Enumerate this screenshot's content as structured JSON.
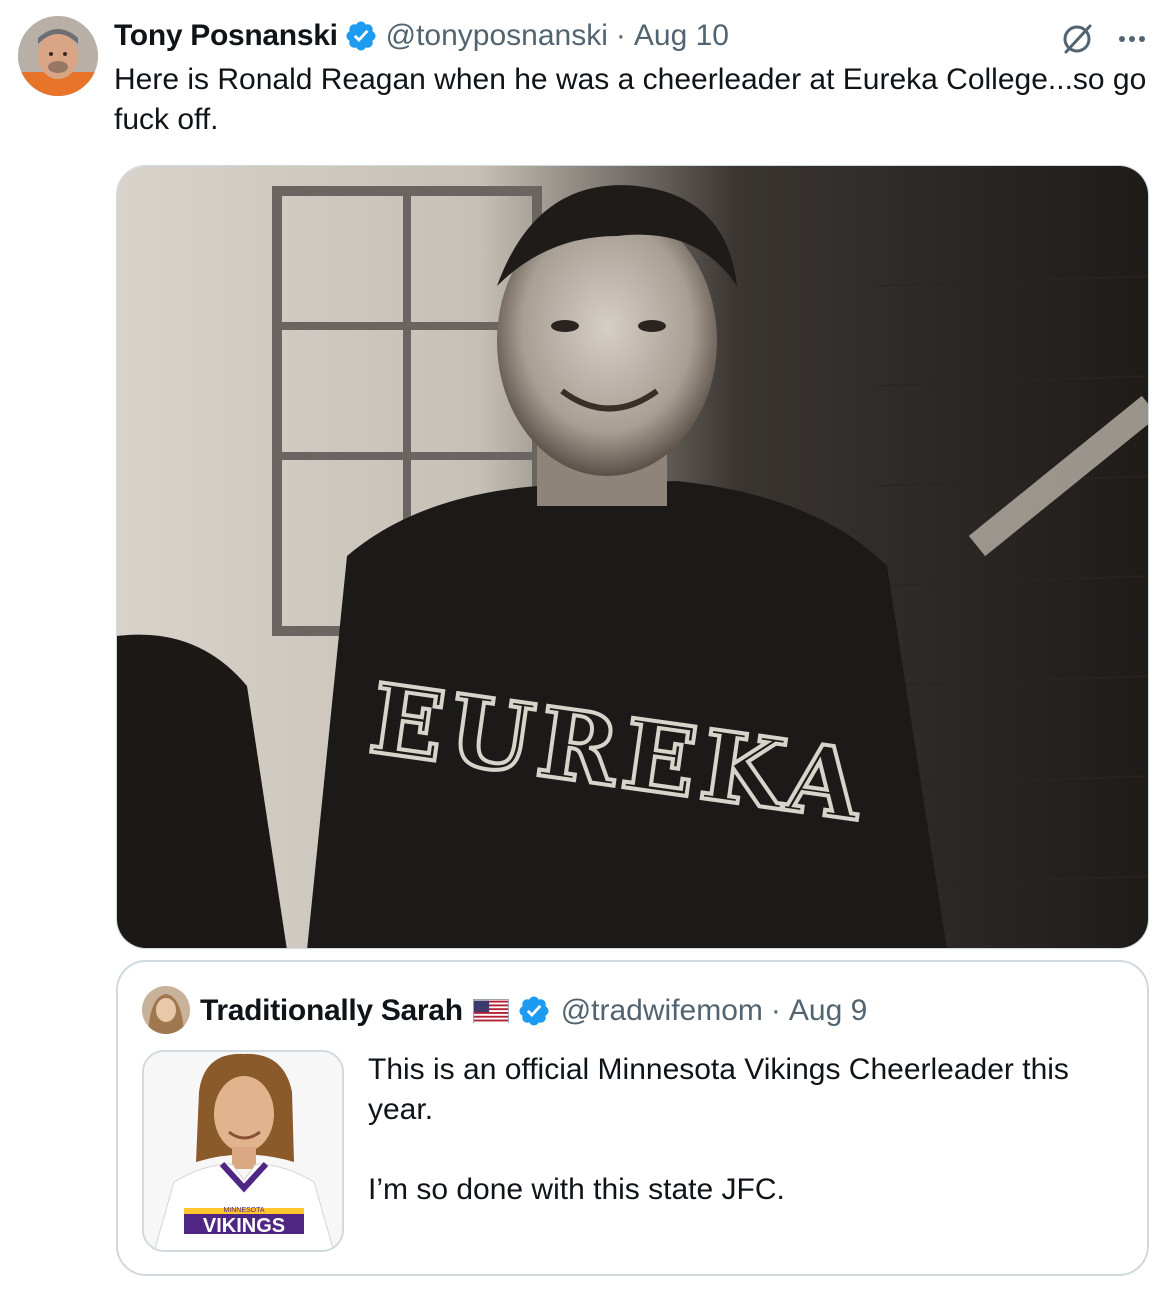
{
  "tweet": {
    "author_name": "Tony Posnanski",
    "handle": "@tonyposnanski",
    "separator": "·",
    "date": "Aug 10",
    "text": "Here is Ronald Reagan when he was a cheerleader at Eureka College...so go fuck off.",
    "verified_color": "#1d9bf0",
    "media": {
      "jersey_text": "EUREKA"
    }
  },
  "icons": {
    "avatar": "avatar",
    "verified": "verified-badge-icon",
    "grok": "grok-icon",
    "more": "more-icon"
  },
  "quote": {
    "author_name": "Traditionally Sarah",
    "flag": "us-flag-icon",
    "handle": "@tradwifemom",
    "separator": "·",
    "date": "Aug 9",
    "text_line1": "This is an official Minnesota Vikings Cheerleader this year.",
    "text_line2": "I’m so done with this state JFC.",
    "thumbnail": {
      "jersey_small_text": "MINNESOTA",
      "jersey_text": "VIKINGS"
    }
  }
}
